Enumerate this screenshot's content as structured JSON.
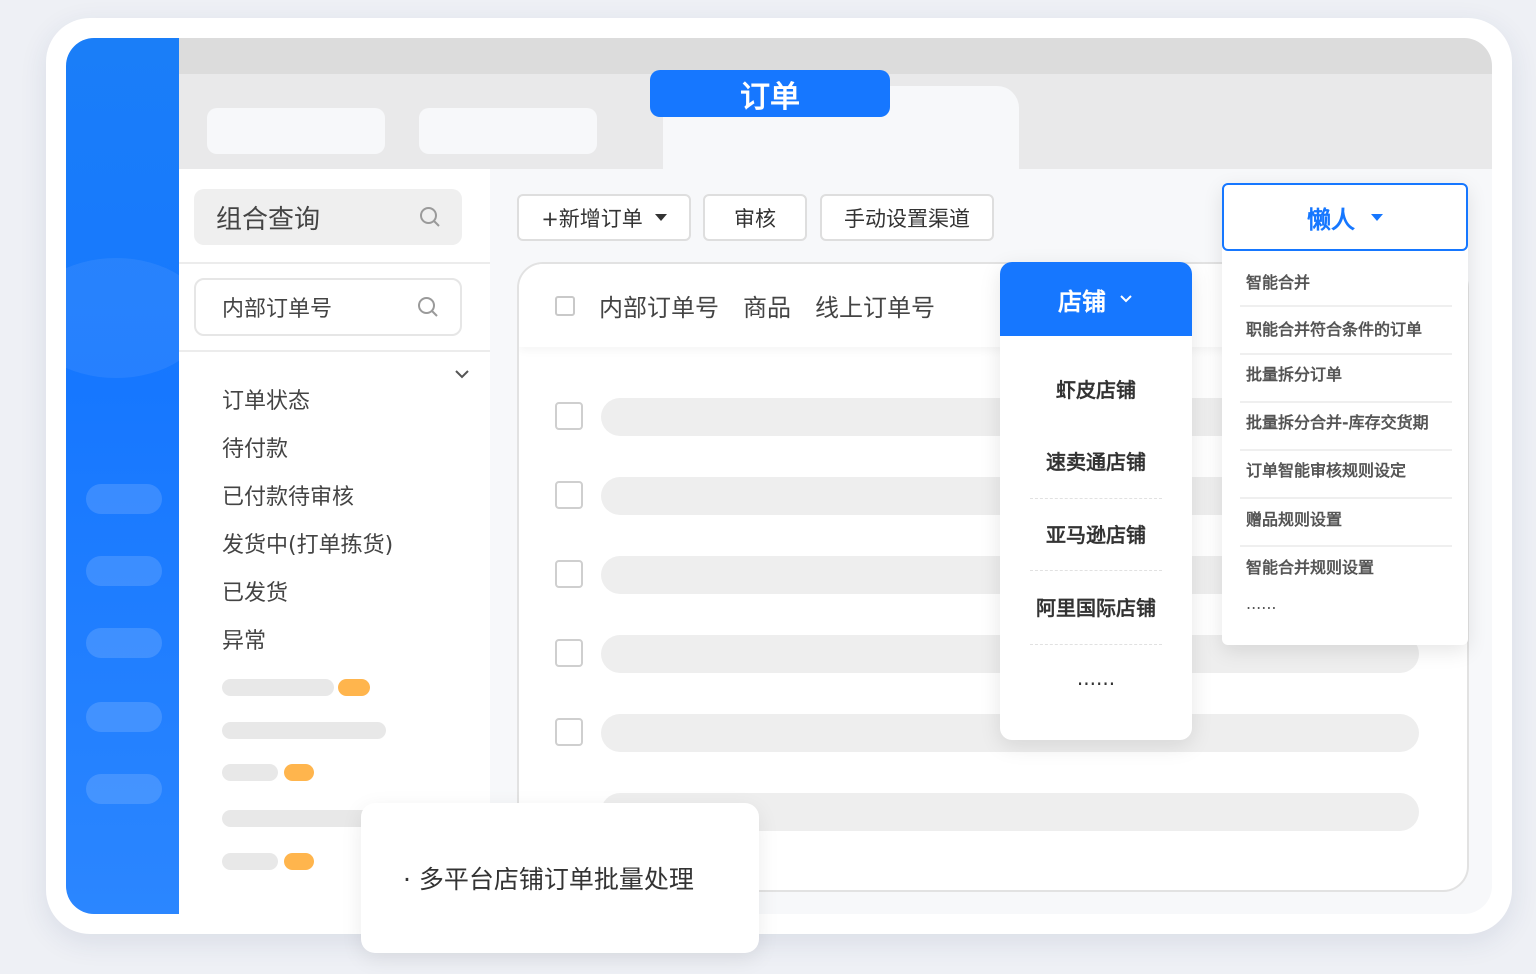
{
  "tabs": {
    "active_label": "订单"
  },
  "left_panel": {
    "combo_query_label": "组合查询",
    "internal_order_label": "内部订单号",
    "status_items": [
      "订单状态",
      "待付款",
      "已付款待审核",
      "发货中(打单拣货)",
      "已发货",
      "异常"
    ]
  },
  "toolbar": {
    "add_order_label": "+新增订单",
    "review_label": "审核",
    "manual_channel_label": "手动设置渠道"
  },
  "table": {
    "columns": [
      "内部订单号",
      "商品",
      "线上订单号"
    ]
  },
  "store_dropdown": {
    "header": "店铺",
    "items": [
      "虾皮店铺",
      "速卖通店铺",
      "亚马逊店铺",
      "阿里国际店铺",
      "......"
    ]
  },
  "lazy_dropdown": {
    "header": "懒人",
    "items": [
      "智能合并",
      "职能合并符合条件的订单",
      "批量拆分订单",
      "批量拆分合并-库存交货期",
      "订单智能审核规则设定",
      "赠品规则设置",
      "智能合并规则设置",
      "......"
    ]
  },
  "callout": {
    "text": "· 多平台店铺订单批量处理"
  },
  "colors": {
    "accent": "#1677ff",
    "tag": "#ffb54d"
  }
}
